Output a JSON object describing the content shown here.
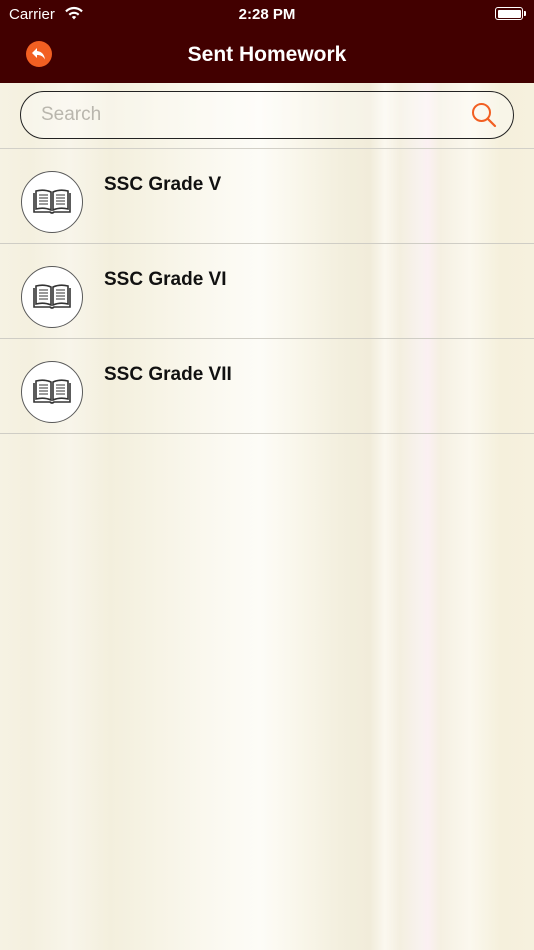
{
  "status_bar": {
    "carrier": "Carrier",
    "time": "2:28 PM",
    "wifi_icon": "wifi-icon",
    "battery_icon": "battery-icon"
  },
  "nav": {
    "title": "Sent Homework",
    "back_icon": "reply-arrow-icon"
  },
  "search": {
    "placeholder": "Search",
    "value": "",
    "icon": "search-icon"
  },
  "list": {
    "items": [
      {
        "label": "SSC Grade V",
        "icon": "open-book-icon"
      },
      {
        "label": "SSC Grade VI",
        "icon": "open-book-icon"
      },
      {
        "label": "SSC Grade VII",
        "icon": "open-book-icon"
      }
    ]
  },
  "colors": {
    "nav_background": "#420000",
    "accent": "#f25f22",
    "text": "#111111"
  }
}
